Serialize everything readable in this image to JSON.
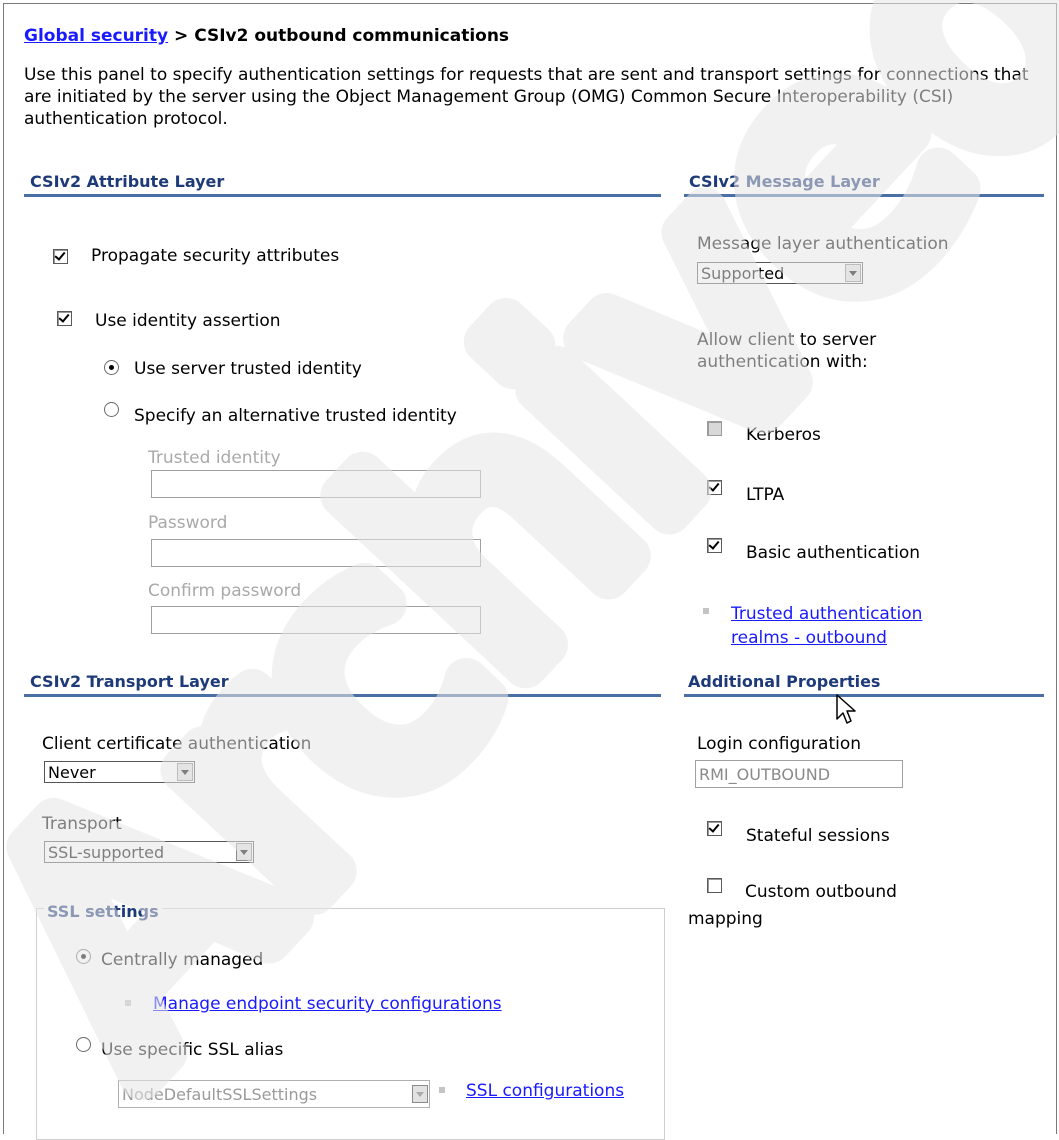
{
  "breadcrumb": {
    "link": "Global security",
    "separator": " > ",
    "current": "CSIv2 outbound communications"
  },
  "description": "Use this panel to specify authentication settings for requests that are sent and transport settings for connections that are initiated by the server using the Object Management Group (OMG) Common Secure Interoperability (CSI) authentication protocol.",
  "attribute_layer": {
    "title": "CSIv2 Attribute Layer",
    "propagate_label": "Propagate security attributes",
    "propagate_checked": true,
    "identity_assertion_label": "Use identity assertion",
    "identity_assertion_checked": true,
    "server_trusted_label": "Use server trusted identity",
    "alternative_label": "Specify an alternative trusted identity",
    "trusted_identity_label": "Trusted identity",
    "trusted_identity_value": "",
    "password_label": "Password",
    "password_value": "",
    "confirm_password_label": "Confirm password",
    "confirm_password_value": ""
  },
  "message_layer": {
    "title": "CSIv2 Message Layer",
    "auth_label": "Message layer authentication",
    "auth_value": "Supported",
    "allow_label": "Allow client to server authentication with:",
    "allow_line1": "Allow client to server",
    "allow_line2": "authentication with:",
    "kerberos_label": "Kerberos",
    "ltpa_label": "LTPA",
    "basic_label": "Basic authentication",
    "realms_link_line1": "Trusted authentication",
    "realms_link_line2": "realms - outbound"
  },
  "transport_layer": {
    "title": "CSIv2 Transport Layer",
    "client_cert_label": "Client certificate authentication",
    "client_cert_value": "Never",
    "transport_label": "Transport",
    "transport_value": "SSL-supported",
    "ssl_settings_title": "SSL settings",
    "centrally_managed_label": "Centrally managed",
    "manage_endpoint_link": "Manage endpoint security configurations",
    "specific_alias_label": "Use specific SSL alias",
    "alias_value": "NodeDefaultSSLSettings",
    "ssl_config_link": "SSL configurations"
  },
  "additional_properties": {
    "title": "Additional Properties",
    "login_config_label": "Login configuration",
    "login_config_value": "RMI_OUTBOUND",
    "stateful_label": "Stateful sessions",
    "custom_mapping_line1": "Custom outbound",
    "custom_mapping_line2": "mapping"
  },
  "watermark": "Archived",
  "colors": {
    "link": "#1a1aff",
    "section_title": "#1e3a78",
    "section_rule": "#4a6fa5"
  }
}
